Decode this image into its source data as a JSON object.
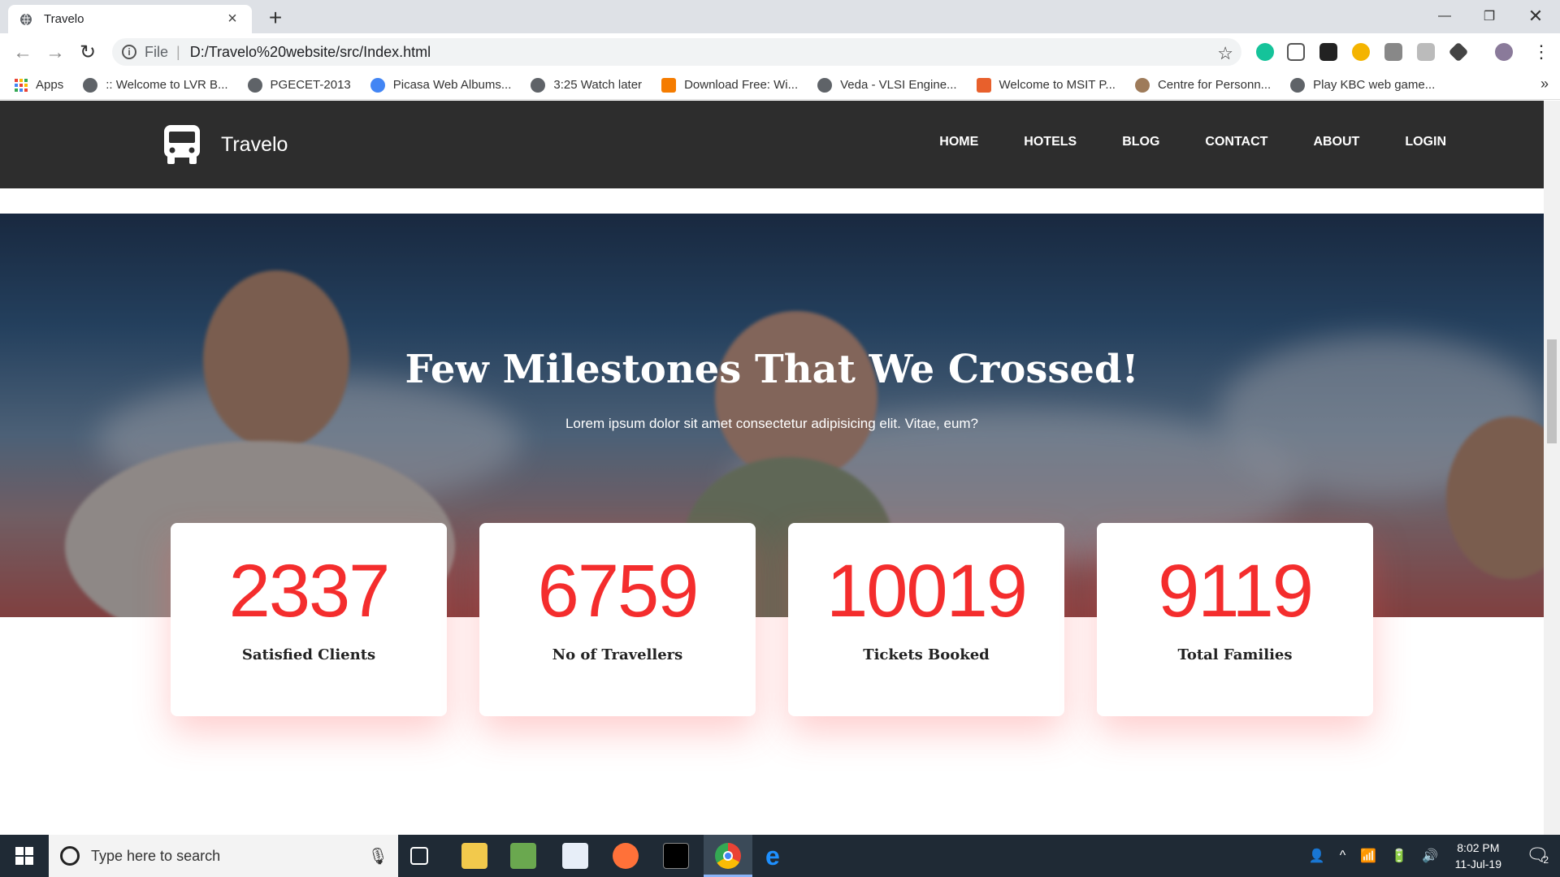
{
  "browser": {
    "tab_title": "Travelo",
    "url_scheme": "File",
    "url": "D:/Travelo%20website/src/Index.html",
    "bookmarks": [
      {
        "label": "Apps"
      },
      {
        "label": ":: Welcome to LVR B..."
      },
      {
        "label": "PGECET-2013"
      },
      {
        "label": "Picasa Web Albums..."
      },
      {
        "label": "3:25 Watch later"
      },
      {
        "label": "Download Free: Wi..."
      },
      {
        "label": "Veda - VLSI Engine..."
      },
      {
        "label": "Welcome to MSIT P..."
      },
      {
        "label": "Centre for Personn..."
      },
      {
        "label": "Play KBC web game..."
      }
    ]
  },
  "site": {
    "brand": "Travelo",
    "nav": [
      "HOME",
      "HOTELS",
      "BLOG",
      "CONTACT",
      "ABOUT",
      "LOGIN"
    ]
  },
  "hero": {
    "headline": "Few Milestones That We Crossed!",
    "subtext": "Lorem ipsum dolor sit amet consectetur adipisicing elit. Vitae, eum?"
  },
  "stats": [
    {
      "value": "2337",
      "label": "Satisfied Clients"
    },
    {
      "value": "6759",
      "label": "No of Travellers"
    },
    {
      "value": "10019",
      "label": "Tickets Booked"
    },
    {
      "value": "9119",
      "label": "Total Families"
    }
  ],
  "taskbar": {
    "search_placeholder": "Type here to search",
    "time": "8:02 PM",
    "date": "11-Jul-19",
    "notification_count": "2"
  },
  "colors": {
    "accent": "#f42d2d",
    "header_bg": "#2d2d2d"
  }
}
